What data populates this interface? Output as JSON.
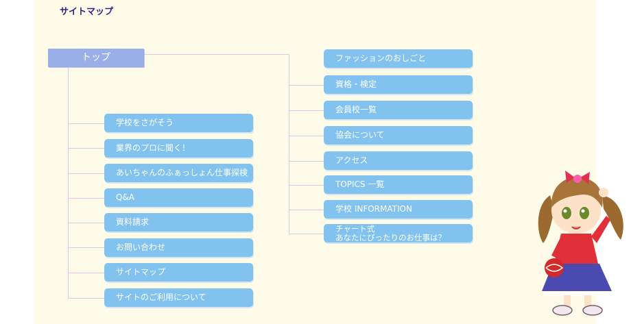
{
  "page_title": "サイトマップ",
  "top": {
    "label": "トップ"
  },
  "left_items": [
    {
      "label": "学校をさがそう"
    },
    {
      "label": "業界のプロに聞く！"
    },
    {
      "label": "あいちゃんのふぁっしょん仕事探検"
    },
    {
      "label": "Q&A"
    },
    {
      "label": "資料請求"
    },
    {
      "label": "お問い合わせ"
    },
    {
      "label": "サイトマップ"
    },
    {
      "label": "サイトのご利用について"
    }
  ],
  "right_items": [
    {
      "label": "ファッションのおしごと"
    },
    {
      "label": "資格・検定"
    },
    {
      "label": "会員校一覧"
    },
    {
      "label": "協会について"
    },
    {
      "label": "アクセス"
    },
    {
      "label": "TOPICS 一覧"
    },
    {
      "label": "学校 INFORMATION"
    },
    {
      "label_line1": "チャート式",
      "label_line2": "あなたにぴったりのお仕事は？"
    }
  ],
  "colors": {
    "button": "#82c2ee",
    "top_button": "#9aaee8",
    "panel": "#fefce8",
    "connector": "#e8c0e8",
    "title": "#3a1a8a"
  }
}
